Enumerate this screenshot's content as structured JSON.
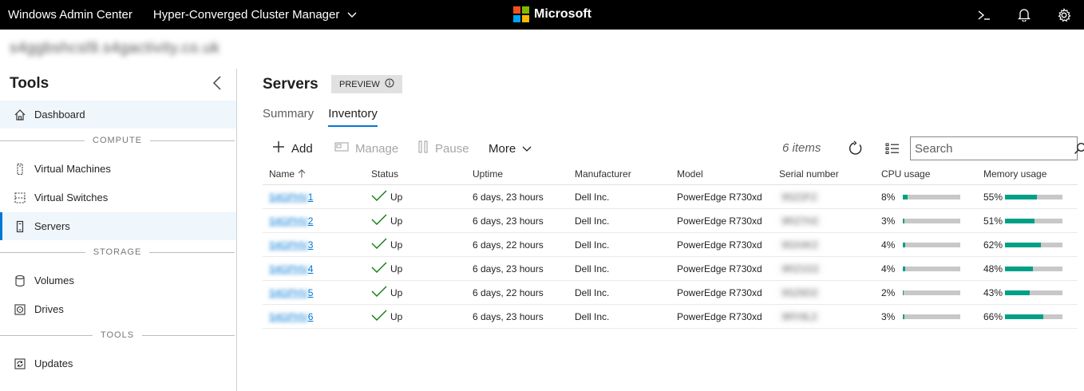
{
  "topbar": {
    "app_title": "Windows Admin Center",
    "app_switcher": "Hyper-Converged Cluster Manager",
    "brand": "Microsoft",
    "icons": [
      "terminal-icon",
      "bell-icon",
      "gear-icon"
    ]
  },
  "connection": {
    "host": "s4ggbshcsl9.s4gactivity.co.uk"
  },
  "sidebar": {
    "title": "Tools",
    "groups": {
      "compute": "COMPUTE",
      "storage": "STORAGE",
      "tools": "TOOLS"
    },
    "items": [
      {
        "label": "Dashboard",
        "icon": "home-icon"
      },
      {
        "label": "Virtual Machines",
        "icon": "vm-icon"
      },
      {
        "label": "Virtual Switches",
        "icon": "switch-icon"
      },
      {
        "label": "Servers",
        "icon": "server-icon"
      },
      {
        "label": "Volumes",
        "icon": "volume-icon"
      },
      {
        "label": "Drives",
        "icon": "drive-icon"
      },
      {
        "label": "Updates",
        "icon": "updates-icon"
      }
    ]
  },
  "main": {
    "title": "Servers",
    "badge": "PREVIEW",
    "tabs": [
      {
        "label": "Summary"
      },
      {
        "label": "Inventory"
      }
    ],
    "toolbar": {
      "add": "Add",
      "manage": "Manage",
      "pause": "Pause",
      "more": "More",
      "items_count": "6 items",
      "search_placeholder": "Search"
    },
    "columns": [
      "Name",
      "Status",
      "Uptime",
      "Manufacturer",
      "Model",
      "Serial number",
      "CPU usage",
      "Memory usage"
    ],
    "rows": [
      {
        "name_prefix": "S4GPHV",
        "name_suffix": "1",
        "status": "Up",
        "uptime": "6 days, 23 hours",
        "manufacturer": "Dell Inc.",
        "model": "PowerEdge R730xd",
        "serial": "9SZ2F2",
        "cpu": "8%",
        "cpu_value": 8,
        "memory": "55%",
        "memory_value": 55
      },
      {
        "name_prefix": "S4GPHV",
        "name_suffix": "2",
        "status": "Up",
        "uptime": "6 days, 23 hours",
        "manufacturer": "Dell Inc.",
        "model": "PowerEdge R730xd",
        "serial": "9RZ7H2",
        "cpu": "3%",
        "cpu_value": 3,
        "memory": "51%",
        "memory_value": 51
      },
      {
        "name_prefix": "S4GPHV",
        "name_suffix": "3",
        "status": "Up",
        "uptime": "6 days, 22 hours",
        "manufacturer": "Dell Inc.",
        "model": "PowerEdge R730xd",
        "serial": "9SX4K2",
        "cpu": "4%",
        "cpu_value": 4,
        "memory": "62%",
        "memory_value": 62
      },
      {
        "name_prefix": "S4GPHV",
        "name_suffix": "4",
        "status": "Up",
        "uptime": "6 days, 23 hours",
        "manufacturer": "Dell Inc.",
        "model": "PowerEdge R730xd",
        "serial": "9RZ1G2",
        "cpu": "4%",
        "cpu_value": 4,
        "memory": "48%",
        "memory_value": 48
      },
      {
        "name_prefix": "S4GPHV",
        "name_suffix": "5",
        "status": "Up",
        "uptime": "6 days, 22 hours",
        "manufacturer": "Dell Inc.",
        "model": "PowerEdge R730xd",
        "serial": "9SZ6D2",
        "cpu": "2%",
        "cpu_value": 2,
        "memory": "43%",
        "memory_value": 43
      },
      {
        "name_prefix": "S4GPHV",
        "name_suffix": "6",
        "status": "Up",
        "uptime": "6 days, 23 hours",
        "manufacturer": "Dell Inc.",
        "model": "PowerEdge R730xd",
        "serial": "9RY8L2",
        "cpu": "3%",
        "cpu_value": 3,
        "memory": "66%",
        "memory_value": 66
      }
    ]
  },
  "colors": {
    "accent": "#0078d4",
    "usage_bar": "#00a086",
    "usage_track": "#c8c8c8",
    "status_ok": "#107c10"
  }
}
